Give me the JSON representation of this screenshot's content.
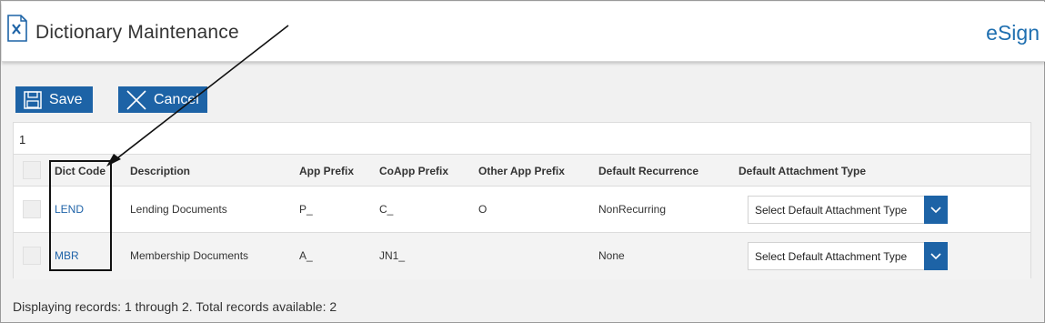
{
  "header": {
    "title": "Dictionary Maintenance",
    "brand": "eSign"
  },
  "toolbar": {
    "save_label": "Save",
    "cancel_label": "Cancel"
  },
  "grid": {
    "pager_number": "1",
    "columns": [
      "Dict Code",
      "Description",
      "App Prefix",
      "CoApp Prefix",
      "Other App Prefix",
      "Default Recurrence",
      "Default Attachment Type"
    ],
    "rows": [
      {
        "dict_code": "LEND",
        "description": "Lending Documents",
        "app_prefix": "P_",
        "coapp_prefix": "C_",
        "other_app_prefix": "O",
        "default_recurrence": "NonRecurring",
        "attachment_select": "Select Default Attachment Type"
      },
      {
        "dict_code": "MBR",
        "description": "Membership Documents",
        "app_prefix": "A_",
        "coapp_prefix": "JN1_",
        "other_app_prefix": "",
        "default_recurrence": "None",
        "attachment_select": "Select Default Attachment Type"
      }
    ]
  },
  "footer": {
    "status": "Displaying records: 1 through 2. Total records available: 2"
  },
  "colors": {
    "accent": "#1d63a6",
    "link": "#1f63a8",
    "brand": "#1f6fb0"
  }
}
